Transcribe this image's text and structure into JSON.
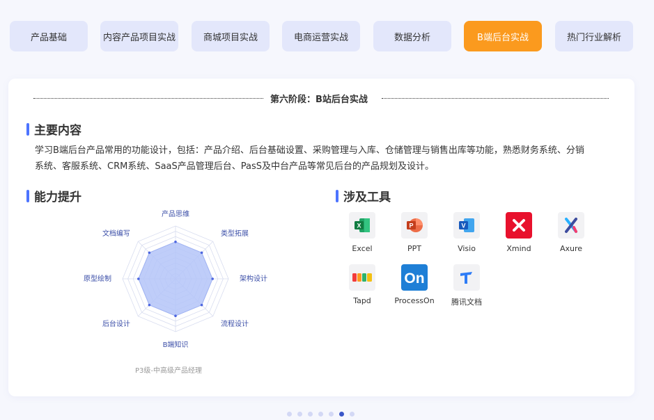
{
  "tabs": [
    {
      "label": "产品基础",
      "active": false
    },
    {
      "label": "内容产品项目实战",
      "active": false
    },
    {
      "label": "商城项目实战",
      "active": false
    },
    {
      "label": "电商运营实战",
      "active": false
    },
    {
      "label": "数据分析",
      "active": false
    },
    {
      "label": "B端后台实战",
      "active": true
    },
    {
      "label": "热门行业解析",
      "active": false
    }
  ],
  "stage_title": "第六阶段：B站后台实战",
  "main_content": {
    "heading": "主要内容",
    "line1": "学习B端后台产品常用的功能设计，包括：产品介绍、后台基础设置、采购管理与入库、仓储管理与销售出库等功能，熟悉财务系统、分销",
    "line2": "系统、客服系统、CRM系统、SaaS产品管理后台、PasS及中台产品等常见后台的产品规划及设计。"
  },
  "ability": {
    "heading": "能力提升",
    "radar_labels": [
      "产品思维",
      "类型拓展",
      "架构设计",
      "流程设计",
      "B端知识",
      "后台设计",
      "原型绘制",
      "文档编写"
    ],
    "radar_values": [
      0.7,
      0.7,
      0.7,
      0.7,
      0.7,
      0.7,
      0.7,
      0.7
    ],
    "caption": "P3级-中高级产品经理",
    "fill_color": "#b4c4f8",
    "point_color": "#4d66e0"
  },
  "tools": {
    "heading": "涉及工具",
    "items": [
      {
        "name": "Excel",
        "icon": "excel-icon"
      },
      {
        "name": "PPT",
        "icon": "powerpoint-icon"
      },
      {
        "name": "Visio",
        "icon": "visio-icon"
      },
      {
        "name": "Xmind",
        "icon": "xmind-icon"
      },
      {
        "name": "Axure",
        "icon": "axure-icon"
      },
      {
        "name": "Tapd",
        "icon": "tapd-icon"
      },
      {
        "name": "ProcessOn",
        "icon": "processon-icon"
      },
      {
        "name": "腾讯文档",
        "icon": "tencent-docs-icon"
      }
    ]
  },
  "pagination": {
    "total": 7,
    "current": 6
  }
}
